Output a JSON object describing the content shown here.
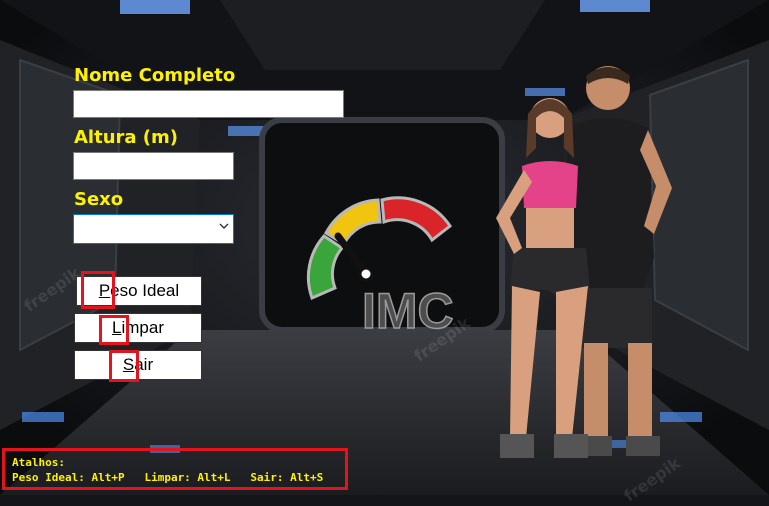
{
  "form": {
    "name_label": "Nome Completo",
    "name_value": "",
    "height_label": "Altura (m)",
    "height_value": "",
    "sex_label": "Sexo",
    "sex_selected": ""
  },
  "buttons": {
    "peso_ideal": {
      "accel": "P",
      "rest": "eso Ideal"
    },
    "limpar": {
      "accel": "L",
      "rest": "impar"
    },
    "sair": {
      "accel": "S",
      "rest": "air"
    }
  },
  "logo": {
    "text": "IMC"
  },
  "shortcuts": {
    "title": "Atalhos:",
    "line": "Peso Ideal: Alt+P   Limpar: Alt+L   Sair: Alt+S"
  },
  "watermark": {
    "text": "freepik"
  },
  "colors": {
    "label": "#fff200",
    "highlight": "#e3141e",
    "gauge_green": "#3aa53a",
    "gauge_yellow": "#f1c40f",
    "gauge_red": "#d9242a"
  }
}
